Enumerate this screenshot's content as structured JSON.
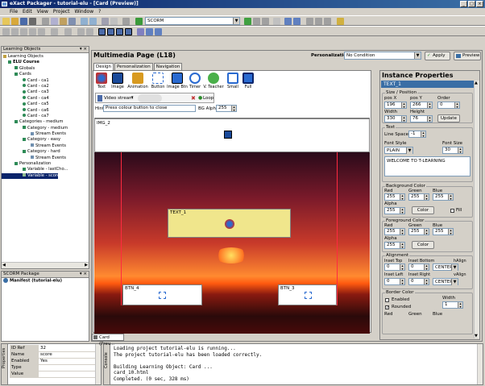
{
  "window": {
    "title": "eXact Packager - tutorial-elu - [Card (Preview)]",
    "controls": [
      "_",
      "□",
      "×"
    ]
  },
  "menu": [
    "File",
    "Edit",
    "View",
    "Project",
    "Window",
    "?"
  ],
  "toolbar": {
    "scorm_combo": "SCORM"
  },
  "learning_objects": {
    "header": "Learning Objects",
    "tree": [
      "Learning Objects",
      "ELU Course",
      "Globals",
      "Cards",
      "Card - ca1",
      "Card - ca2",
      "Card - ca3",
      "Card - ca4",
      "Card - ca5",
      "Card - ca6",
      "Card - ca7",
      "Categories - medium",
      "Category - medium",
      "Stream Events",
      "Category - easy",
      "Stream Events",
      "Category - hard",
      "Stream Events",
      "Personalization",
      "Variable - lastCho...",
      "Variable - score"
    ]
  },
  "scorm_package": {
    "header": "SCORM Package",
    "item": "Manifest (tutorial-elu)"
  },
  "properties": {
    "rows": [
      {
        "key": "ID Ref",
        "value": "32"
      },
      {
        "key": "Name",
        "value": "score"
      },
      {
        "key": "Enabled",
        "value": "Yes"
      },
      {
        "key": "Type",
        "value": ""
      },
      {
        "key": "Value",
        "value": ""
      }
    ],
    "side_label": "Properties"
  },
  "editor": {
    "title": "Multimedia Page (L18)",
    "personalization_label": "Personalization",
    "personalization_value": "No Condition",
    "apply": "Apply",
    "preview": "Preview",
    "tabs": [
      "Design",
      "Personalization",
      "Navigation"
    ],
    "components": [
      "Text",
      "Image",
      "Animation",
      "Button",
      "Image Btn",
      "Timer",
      "V. Teacher",
      "Small",
      "Full"
    ],
    "video_stream": "Video stream",
    "loop": "Loop",
    "hint_label": "Hint",
    "hint_value": "Press colour button to close",
    "bg_alpha_label": "BG Alpha",
    "bg_alpha_value": "255",
    "canvas_labels": {
      "img": "IMG_2",
      "text": "TEXT_1",
      "btn4": "BTN_4",
      "btn3": "BTN_3"
    },
    "bottom_tab": "Card (Prev..."
  },
  "instance": {
    "title": "Instance Properties",
    "selected": "TEXT_1",
    "size_position": {
      "title": "Size / Position",
      "posx_label": "pos X",
      "posx": "196",
      "posy_label": "pos Y",
      "posy": "266",
      "order_label": "Order",
      "order": "0",
      "width_label": "Width",
      "width": "330",
      "height_label": "Height",
      "height": "76",
      "update": "Update"
    },
    "text": {
      "title": "Text",
      "line_space_label": "Line Space",
      "line_space": "-1",
      "font_style_label": "Font Style",
      "font_style": "PLAIN",
      "font_size_label": "Font Size",
      "font_size": "30",
      "content": "WELCOME TO T-LEARNING"
    },
    "bg_color": {
      "title": "Background Color",
      "red_label": "Red",
      "green_label": "Green",
      "blue_label": "Blue",
      "red": "255",
      "green": "255",
      "blue": "255",
      "alpha_label": "Alpha",
      "alpha": "255",
      "color_btn": "Color",
      "fill": "Fill"
    },
    "fg_color": {
      "title": "Foreground Color",
      "red_label": "Red",
      "green_label": "Green",
      "blue_label": "Blue",
      "red": "255",
      "green": "255",
      "blue": "255",
      "alpha_label": "Alpha",
      "alpha": "255",
      "color_btn": "Color"
    },
    "alignment": {
      "title": "Alignment",
      "inset_top_label": "Inset Top",
      "inset_bottom_label": "Inset Bottom",
      "halign_label": "hAlign",
      "inset_top": "0",
      "inset_bottom": "0",
      "halign": "CENTER",
      "inset_left_label": "Inset Left",
      "inset_right_label": "Inset Right",
      "valign_label": "vAlign",
      "inset_left": "0",
      "inset_right": "0",
      "valign": "CENTER"
    },
    "border": {
      "title": "Border Color",
      "enabled": "Enabled",
      "width_label": "Width",
      "width": "1",
      "rounded": "Rounded",
      "red_label": "Red",
      "green_label": "Green",
      "blue_label": "Blue"
    }
  },
  "console": {
    "lines": [
      "Loading project tutorial-elu is running...",
      "The project tutorial-elu has been loaded correctly.",
      "",
      "Building Learning Object: Card ...",
      "card_10.html",
      "Completed. (0 sec, 328 ms)"
    ],
    "side_label": "Console"
  },
  "colors": {
    "accent": "#0a246a",
    "text_box": "#f0e68c",
    "panel_bg": "#d4d0c8",
    "tree_icon": "#2e8b57"
  }
}
